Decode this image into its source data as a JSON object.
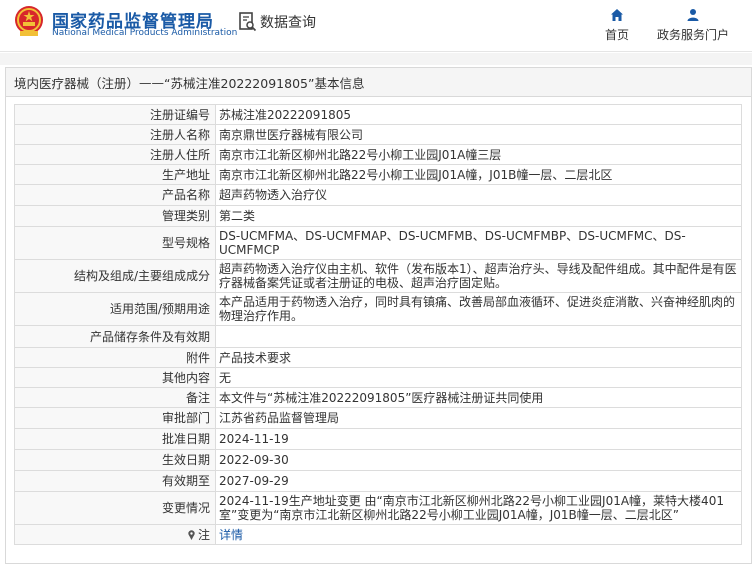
{
  "header": {
    "brand_cn": "国家药品监督管理局",
    "brand_en": "National Medical Products Administration",
    "page_label": "数据查询",
    "nav": [
      {
        "label": "首页",
        "icon": "home-icon"
      },
      {
        "label": "政务服务门户",
        "icon": "user-icon"
      }
    ]
  },
  "breadcrumb": {
    "section": "境内医疗器械（注册）",
    "separator": " —— ",
    "title": "“苏械注准20222091805”基本信息"
  },
  "details": [
    {
      "key": "注册证编号",
      "value": "苏械注准20222091805"
    },
    {
      "key": "注册人名称",
      "value": "南京鼎世医疗器械有限公司"
    },
    {
      "key": "注册人住所",
      "value": "南京市江北新区柳州北路22号小柳工业园J01A幢三层"
    },
    {
      "key": "生产地址",
      "value": "南京市江北新区柳州北路22号小柳工业园J01A幢，J01B幢一层、二层北区"
    },
    {
      "key": "产品名称",
      "value": "超声药物透入治疗仪"
    },
    {
      "key": "管理类别",
      "value": "第二类"
    },
    {
      "key": "型号规格",
      "value": "DS-UCMFMA、DS-UCMFMAP、DS-UCMFMB、DS-UCMFMBP、DS-UCMFMC、DS-UCMFMCP"
    },
    {
      "key": "结构及组成/主要组成成分",
      "value": "超声药物透入治疗仪由主机、软件（发布版本1）、超声治疗头、导线及配件组成。其中配件是有医疗器械备案凭证或者注册证的电极、超声治疗固定贴。"
    },
    {
      "key": "适用范围/预期用途",
      "value": "本产品适用于药物透入治疗，同时具有镇痛、改善局部血液循环、促进炎症消散、兴奋神经肌肉的物理治疗作用。"
    },
    {
      "key": "产品储存条件及有效期",
      "value": ""
    },
    {
      "key": "附件",
      "value": "产品技术要求"
    },
    {
      "key": "其他内容",
      "value": "无"
    },
    {
      "key": "备注",
      "value": "本文件与“苏械注准20222091805”医疗器械注册证共同使用"
    },
    {
      "key": "审批部门",
      "value": "江苏省药品监督管理局"
    },
    {
      "key": "批准日期",
      "value": "2024-11-19"
    },
    {
      "key": "生效日期",
      "value": "2022-09-30"
    },
    {
      "key": "有效期至",
      "value": "2027-09-29"
    },
    {
      "key": "变更情况",
      "value": "2024-11-19生产地址变更 由“南京市江北新区柳州北路22号小柳工业园J01A幢，莱特大楼401室”变更为“南京市江北新区柳州北路22号小柳工业园J01A幢，J01B幢一层、二层北区”"
    }
  ],
  "note": {
    "key": "注",
    "icon": "pin-icon",
    "value": "详情"
  },
  "colors": {
    "brand": "#1a5aa6",
    "emblem_red": "#d7262b",
    "emblem_gold": "#f2c037"
  }
}
